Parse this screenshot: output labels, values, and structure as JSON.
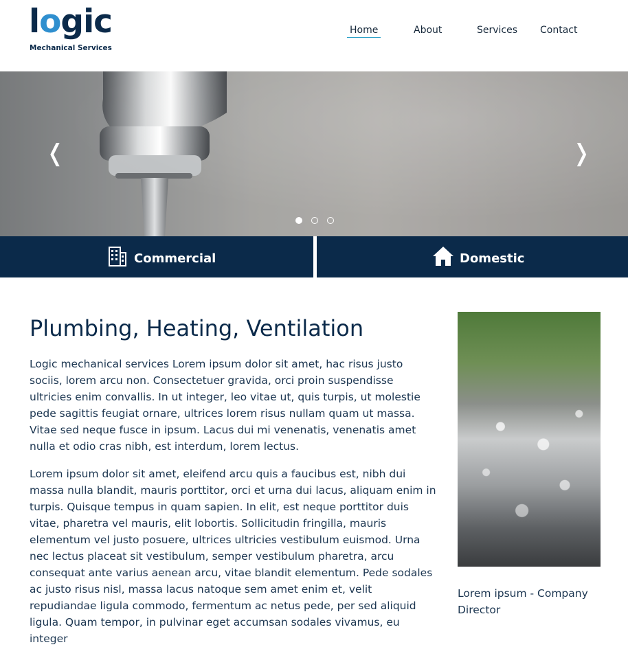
{
  "brand": {
    "logo_word": "logic",
    "logo_o": "o",
    "tagline": "Mechanical Services",
    "accent_color": "#2f8fcf",
    "navy_color": "#0b2a4a"
  },
  "nav": {
    "items": [
      {
        "label": "Home",
        "active": true
      },
      {
        "label": "About",
        "active": false
      },
      {
        "label": "Services",
        "active": false
      },
      {
        "label": "Contact",
        "active": false
      }
    ]
  },
  "hero": {
    "prev_icon": "chevron-left-icon",
    "next_icon": "chevron-right-icon",
    "prev_glyph": "❬",
    "next_glyph": "❭",
    "slides_count": 3,
    "active_slide": 1
  },
  "categories": [
    {
      "label": "Commercial",
      "icon": "building-icon"
    },
    {
      "label": "Domestic",
      "icon": "home-icon"
    }
  ],
  "main": {
    "title": "Plumbing, Heating, Ventilation",
    "paragraphs": [
      "Logic mechanical services Lorem ipsum dolor sit amet, hac risus justo sociis, lorem arcu non. Consectetuer gravida, orci proin suspendisse ultricies enim convallis. In ut integer, leo vitae ut, quis turpis, ut molestie pede sagittis feugiat ornare, ultrices lorem risus nullam quam ut massa. Vitae sed neque fusce in ipsum. Lacus dui mi venenatis, venenatis amet nulla et odio cras nibh, est interdum, lorem lectus.",
      "Lorem ipsum dolor sit amet, eleifend arcu quis a faucibus est, nibh dui massa nulla blandit, mauris porttitor, orci et urna dui lacus, aliquam enim in turpis. Quisque tempus in quam sapien. In elit, est neque porttitor duis vitae, pharetra vel mauris, elit lobortis. Sollicitudin fringilla, mauris elementum vel justo posuere, ultrices ultricies vestibulum euismod. Urna nec lectus placeat sit vestibulum, semper vestibulum pharetra, arcu consequat ante varius aenean arcu, vitae blandit elementum. Pede sodales ac justo risus nisl, massa lacus natoque sem amet enim et, velit repudiandae ligula commodo, fermentum ac netus pede, per sed aliquid ligula. Quam tempor, in pulvinar eget accumsan sodales vivamus, eu integer"
    ],
    "caption": "Lorem ipsum - Company Director"
  }
}
